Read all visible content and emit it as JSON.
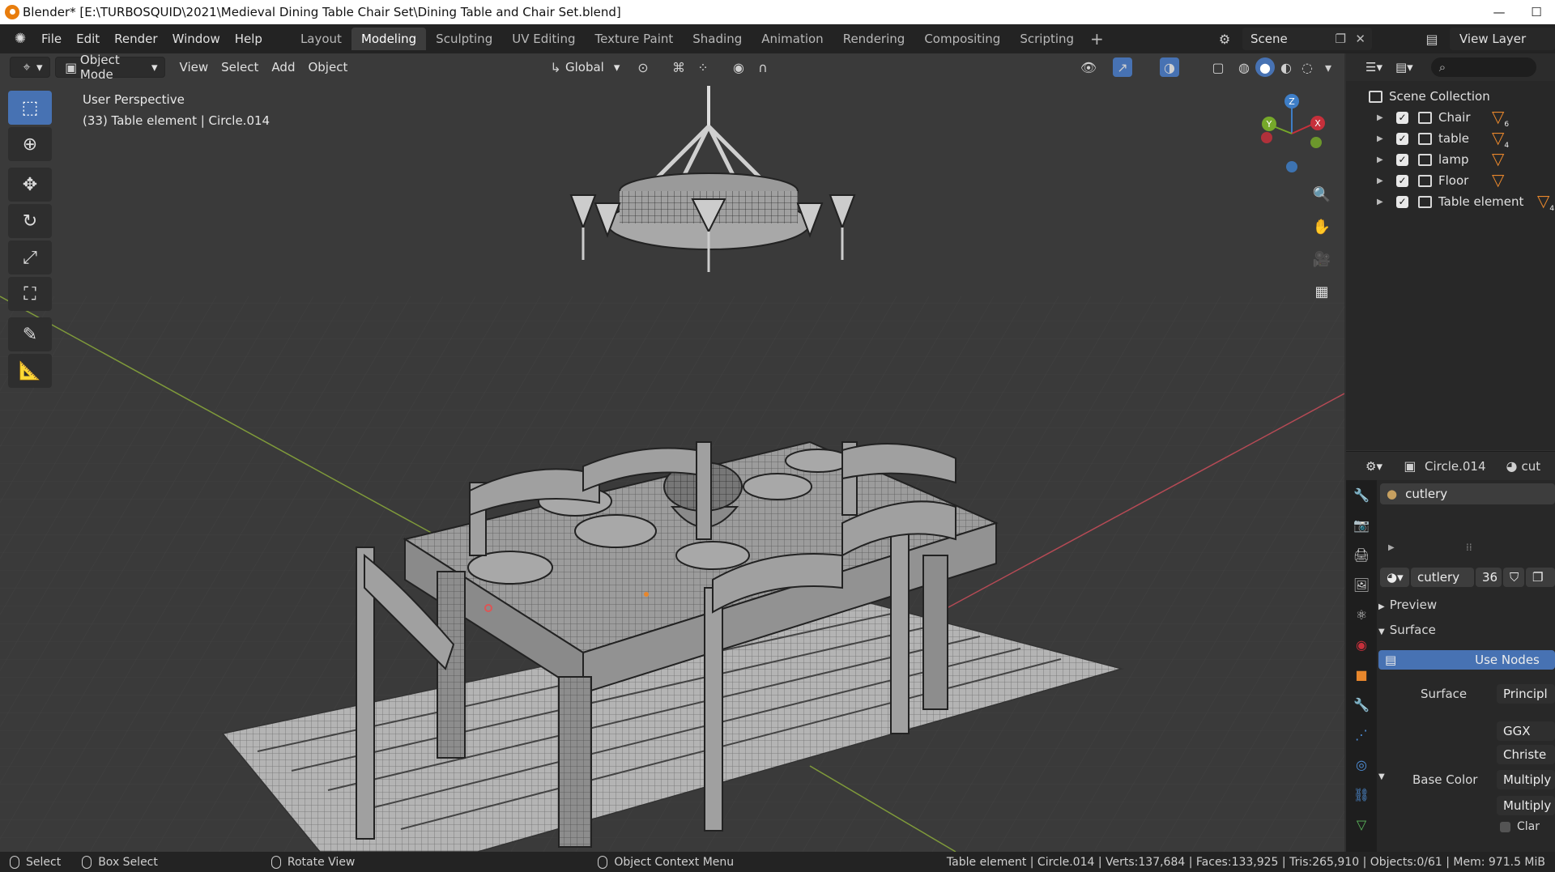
{
  "titlebar": {
    "title": "Blender* [E:\\TURBOSQUID\\2021\\Medieval Dining Table Chair Set\\Dining Table and Chair Set.blend]",
    "minimize": "—",
    "maximize": "☐"
  },
  "menu": {
    "items": [
      "File",
      "Edit",
      "Render",
      "Window",
      "Help"
    ]
  },
  "workspaces": {
    "tabs": [
      "Layout",
      "Modeling",
      "Sculpting",
      "UV Editing",
      "Texture Paint",
      "Shading",
      "Animation",
      "Rendering",
      "Compositing",
      "Scripting"
    ],
    "active": "Modeling",
    "add": "+"
  },
  "scene": {
    "name": "Scene",
    "view_layer": "View Layer"
  },
  "viewport_header": {
    "mode": "Object Mode",
    "menus": [
      "View",
      "Select",
      "Add",
      "Object"
    ],
    "orientation": "Global"
  },
  "viewport": {
    "perspective": "User Perspective",
    "active_info": "(33) Table element | Circle.014",
    "axes": {
      "x": "X",
      "y": "Y",
      "z": "Z"
    }
  },
  "outliner": {
    "root": "Scene Collection",
    "collections": [
      {
        "name": "Chair",
        "count": "6"
      },
      {
        "name": "table",
        "count": "4"
      },
      {
        "name": "lamp",
        "count": ""
      },
      {
        "name": "Floor",
        "count": ""
      },
      {
        "name": "Table element",
        "count": "4"
      }
    ]
  },
  "properties": {
    "object": "Circle.014",
    "header_extra": "cut",
    "material_slot": "cutlery",
    "material_name": "cutlery",
    "users": "36",
    "preview": "Preview",
    "surface_section": "Surface",
    "use_nodes": "Use Nodes",
    "surface_label": "Surface",
    "surface_value": "Principl",
    "distribution": "GGX",
    "subsurface": "Christe",
    "base_color_label": "Base Color",
    "base_color_value": "Multiply",
    "base_color_value2": "Multiply",
    "clamp": "Clar"
  },
  "statusbar": {
    "select": "Select",
    "box_select": "Box Select",
    "rotate": "Rotate View",
    "context_menu": "Object Context Menu",
    "stats": "Table element | Circle.014 | Verts:137,684 | Faces:133,925 | Tris:265,910 | Objects:0/61 | Mem: 971.5 MiB"
  },
  "colors": {
    "accent": "#4772b3",
    "orange": "#e8872c",
    "x_axis": "#c6303b",
    "y_axis": "#76a82a",
    "z_axis": "#3e7ec7"
  }
}
